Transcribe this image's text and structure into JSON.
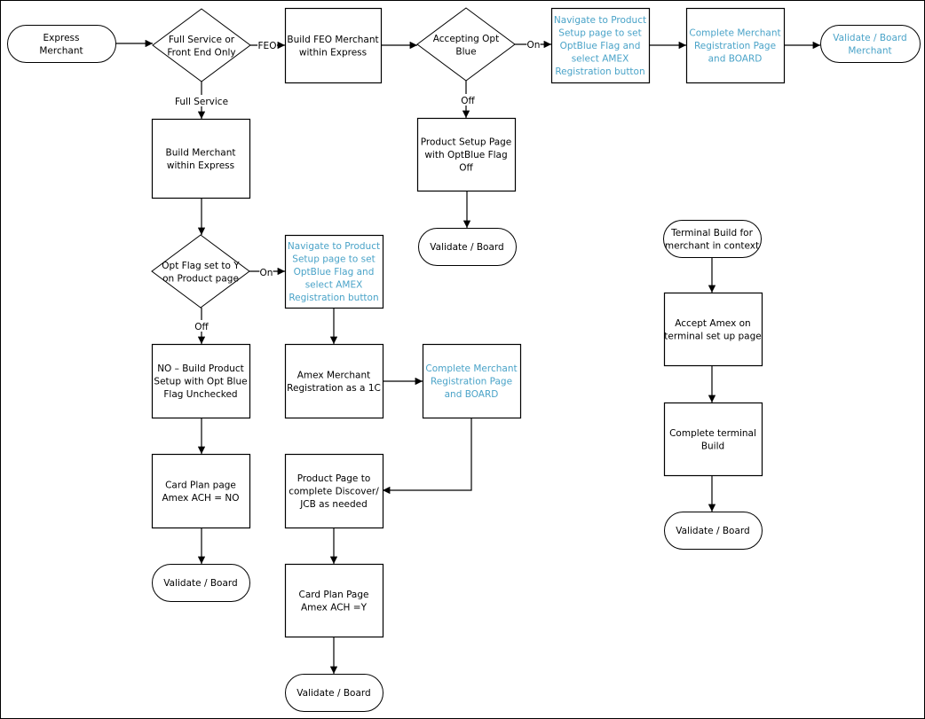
{
  "colors": {
    "line": "#000000",
    "blue_text": "#4aa3c8",
    "text": "#000000"
  },
  "nodes": {
    "express_merchant": {
      "type": "terminator",
      "lines": [
        "Express",
        "Merchant"
      ]
    },
    "full_service_decision": {
      "type": "decision",
      "lines": [
        "Full Service or",
        "Front End Only"
      ]
    },
    "build_feo": {
      "type": "process",
      "lines": [
        "Build FEO Merchant",
        "within Express"
      ]
    },
    "accepting_optblue": {
      "type": "decision",
      "lines": [
        "Accepting Opt",
        "Blue"
      ]
    },
    "navigate_top": {
      "type": "process",
      "highlight": true,
      "lines": [
        "Navigate to Product",
        "Setup page to set",
        "OptBlue Flag and",
        "select AMEX",
        "Registration button"
      ]
    },
    "complete_reg_top": {
      "type": "process",
      "highlight": true,
      "lines": [
        "Complete Merchant",
        "Registration Page",
        "and BOARD"
      ]
    },
    "validate_board_merchant": {
      "type": "terminator",
      "highlight": true,
      "lines": [
        "Validate / Board",
        "Merchant"
      ]
    },
    "build_merchant": {
      "type": "process",
      "lines": [
        "Build Merchant",
        "within Express"
      ]
    },
    "product_setup_off": {
      "type": "process",
      "lines": [
        "Product Setup Page",
        "with OptBlue Flag",
        "Off"
      ]
    },
    "validate_board_mid": {
      "type": "terminator",
      "lines": [
        "Validate / Board"
      ]
    },
    "opt_flag_decision": {
      "type": "decision",
      "lines": [
        "Opt Flag set to Y",
        "on Product page"
      ]
    },
    "navigate_mid": {
      "type": "process",
      "highlight": true,
      "lines": [
        "Navigate to Product",
        "Setup page to set",
        "OptBlue Flag and",
        "select AMEX",
        "Registration button"
      ]
    },
    "no_build_product": {
      "type": "process",
      "lines": [
        "NO – Build Product",
        "Setup with Opt Blue",
        "Flag Unchecked"
      ]
    },
    "amex_registration": {
      "type": "process",
      "lines": [
        "Amex Merchant",
        "Registration as a 1C"
      ]
    },
    "complete_reg_mid": {
      "type": "process",
      "highlight": true,
      "lines": [
        "Complete Merchant",
        "Registration Page",
        "and BOARD"
      ]
    },
    "card_plan_no": {
      "type": "process",
      "lines": [
        "Card Plan page",
        "Amex ACH = NO"
      ]
    },
    "validate_board_left": {
      "type": "terminator",
      "lines": [
        "Validate / Board"
      ]
    },
    "product_page_discover": {
      "type": "process",
      "lines": [
        "Product Page to",
        "complete Discover/",
        "JCB as needed"
      ]
    },
    "card_plan_y": {
      "type": "process",
      "lines": [
        "Card Plan Page",
        "Amex ACH =Y"
      ]
    },
    "validate_board_center": {
      "type": "terminator",
      "lines": [
        "Validate / Board"
      ]
    },
    "terminal_build": {
      "type": "terminator",
      "lines": [
        "Terminal Build for",
        "merchant in context"
      ]
    },
    "accept_amex_terminal": {
      "type": "process",
      "lines": [
        "Accept Amex on",
        "terminal set up page"
      ]
    },
    "complete_terminal": {
      "type": "process",
      "lines": [
        "Complete terminal",
        "Build"
      ]
    },
    "validate_board_right": {
      "type": "terminator",
      "lines": [
        "Validate / Board"
      ]
    }
  },
  "edges": [
    {
      "from": "express_merchant",
      "to": "full_service_decision",
      "label": ""
    },
    {
      "from": "full_service_decision",
      "to": "build_feo",
      "label": "FEO"
    },
    {
      "from": "full_service_decision",
      "to": "build_merchant",
      "label": "Full Service"
    },
    {
      "from": "build_feo",
      "to": "accepting_optblue",
      "label": ""
    },
    {
      "from": "accepting_optblue",
      "to": "navigate_top",
      "label": "On"
    },
    {
      "from": "accepting_optblue",
      "to": "product_setup_off",
      "label": "Off"
    },
    {
      "from": "navigate_top",
      "to": "complete_reg_top",
      "label": ""
    },
    {
      "from": "complete_reg_top",
      "to": "validate_board_merchant",
      "label": ""
    },
    {
      "from": "product_setup_off",
      "to": "validate_board_mid",
      "label": ""
    },
    {
      "from": "build_merchant",
      "to": "opt_flag_decision",
      "label": ""
    },
    {
      "from": "opt_flag_decision",
      "to": "navigate_mid",
      "label": "On"
    },
    {
      "from": "opt_flag_decision",
      "to": "no_build_product",
      "label": "Off"
    },
    {
      "from": "navigate_mid",
      "to": "amex_registration",
      "label": ""
    },
    {
      "from": "amex_registration",
      "to": "complete_reg_mid",
      "label": ""
    },
    {
      "from": "complete_reg_mid",
      "to": "product_page_discover",
      "label": ""
    },
    {
      "from": "no_build_product",
      "to": "card_plan_no",
      "label": ""
    },
    {
      "from": "card_plan_no",
      "to": "validate_board_left",
      "label": ""
    },
    {
      "from": "product_page_discover",
      "to": "card_plan_y",
      "label": ""
    },
    {
      "from": "card_plan_y",
      "to": "validate_board_center",
      "label": ""
    },
    {
      "from": "terminal_build",
      "to": "accept_amex_terminal",
      "label": ""
    },
    {
      "from": "accept_amex_terminal",
      "to": "complete_terminal",
      "label": ""
    },
    {
      "from": "complete_terminal",
      "to": "validate_board_right",
      "label": ""
    }
  ]
}
